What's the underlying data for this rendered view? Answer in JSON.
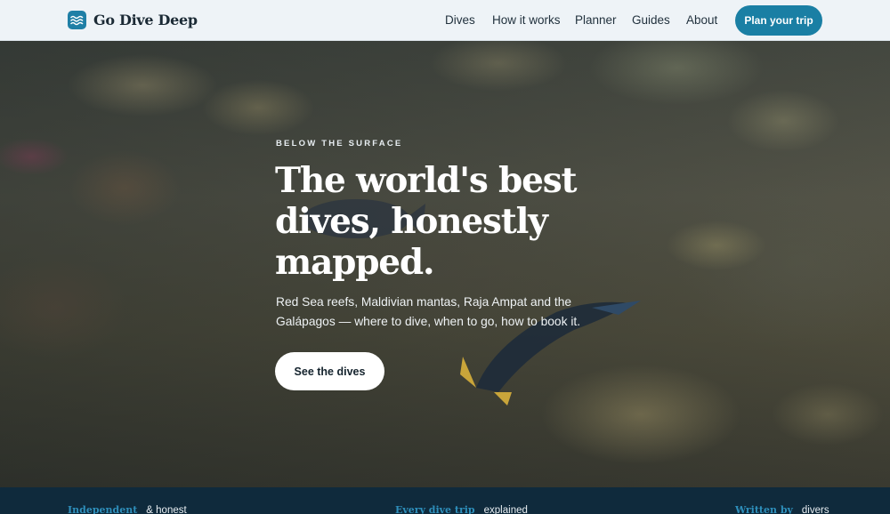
{
  "brand": {
    "name": "Go Dive Deep",
    "logo_icon": "wave-icon",
    "accent": "#1a7fa4"
  },
  "nav": {
    "items": [
      {
        "label": "Dives"
      },
      {
        "label": "How it works"
      },
      {
        "label": "Planner"
      },
      {
        "label": "Guides"
      },
      {
        "label": "About"
      }
    ],
    "cta_label": "Plan your trip"
  },
  "hero": {
    "eyebrow": "BELOW THE SURFACE",
    "headline_lines": [
      "The world's best",
      "dives, honestly",
      "mapped."
    ],
    "subtext": "Red Sea reefs, Maldivian mantas, Raja Ampat and the Galápagos — where to dive, when to go, how to book it.",
    "button_label": "See the dives"
  },
  "strip": {
    "items": [
      {
        "key": "Independent",
        "value": "& honest"
      },
      {
        "key": "Every dive trip",
        "value": "explained"
      },
      {
        "key": "Written by",
        "value": "divers"
      }
    ]
  }
}
